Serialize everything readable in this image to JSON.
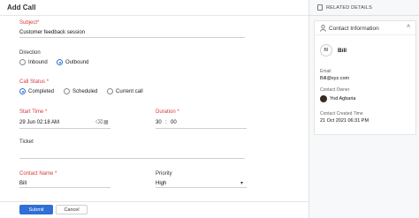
{
  "header": {
    "title": "Add Call"
  },
  "form": {
    "subject": {
      "label": "Subject",
      "required_mark": "*",
      "value": "Customer feedback session"
    },
    "direction": {
      "label": "Direction",
      "options": [
        "Inbound",
        "Outbound"
      ],
      "selected": "Outbound"
    },
    "call_status": {
      "label": "Call Status",
      "required_mark": "*",
      "options": [
        "Completed",
        "Scheduled",
        "Current call"
      ],
      "selected": "Completed"
    },
    "start_time": {
      "label": "Start Time",
      "required_mark": "*",
      "value": "29 Jun 02:18 AM"
    },
    "duration": {
      "label": "Duration",
      "required_mark": "*",
      "minutes": "30",
      "separator": ":",
      "seconds": "00"
    },
    "ticket": {
      "label": "Ticket",
      "value": ""
    },
    "contact_name": {
      "label": "Contact Name",
      "required_mark": "*",
      "value": "Bill"
    },
    "priority": {
      "label": "Priority",
      "value": "High"
    }
  },
  "footer": {
    "submit_label": "Submit",
    "cancel_label": "Cancel"
  },
  "sidebar": {
    "header_label": "RELATED DETAILS",
    "card": {
      "title": "Contact Information",
      "avatar_initials": "BI",
      "name": "Bill",
      "email_label": "Email",
      "email_value": "Bill@xyz.com",
      "owner_label": "Contact Owner",
      "owner_value": "Yod Agbaria",
      "created_label": "Contact Created Time",
      "created_value": "21 Oct 2021 06:31 PM"
    }
  },
  "colors": {
    "accent": "#2f6fd6",
    "required": "#d83a3a"
  }
}
